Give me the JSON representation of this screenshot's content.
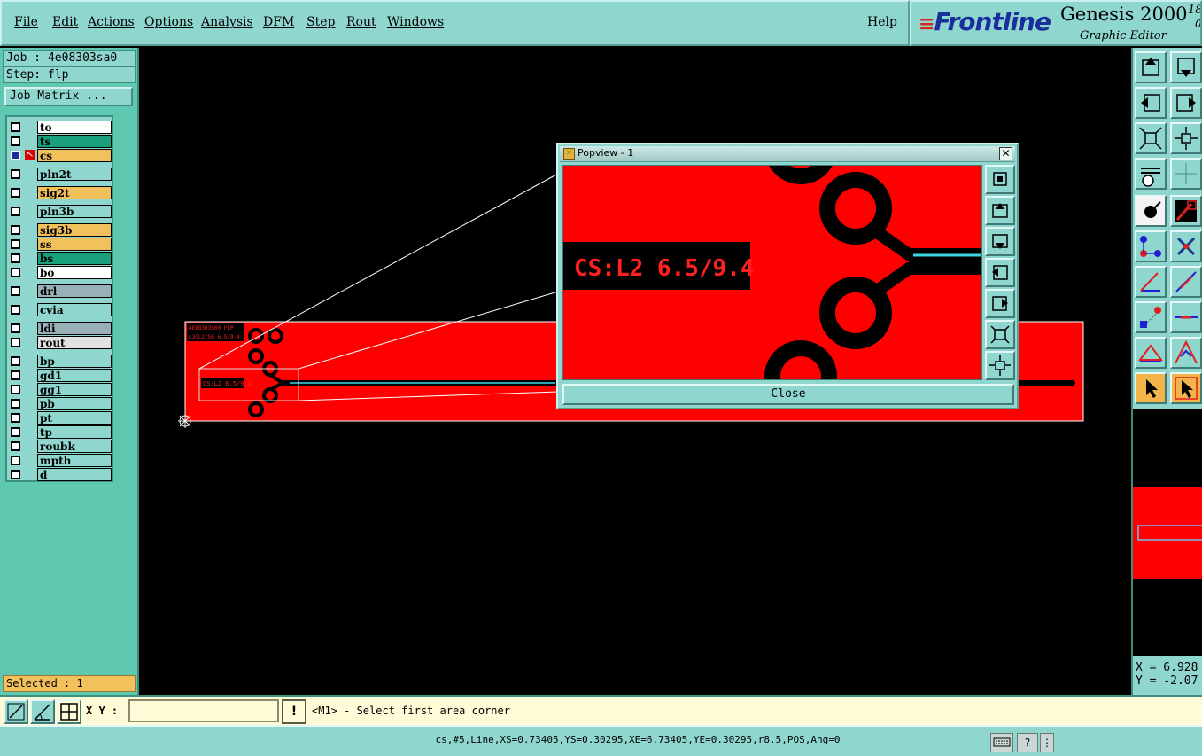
{
  "menu": {
    "items": [
      "File",
      "Edit",
      "Actions",
      "Options",
      "Analysis",
      "DFM",
      "Step",
      "Rout",
      "Windows"
    ],
    "help": "Help"
  },
  "brand": {
    "logo": "Frontline",
    "product": "Genesis 2000",
    "subtitle": "Graphic Editor",
    "version_top": "18",
    "version_bottom": "0"
  },
  "job": {
    "job_label": "Job : 4e08303sa0",
    "step_label": "Step: flp",
    "matrix_button": "Job Matrix ..."
  },
  "layers": [
    {
      "name": "to",
      "color": "#ffffff"
    },
    {
      "name": "ts",
      "color": "#1aa07a"
    },
    {
      "name": "cs",
      "color": "#f3c15c",
      "active": true
    },
    {
      "name": "pln2t",
      "color": "#8fd6cf"
    },
    {
      "name": "sig2t",
      "color": "#f3c15c"
    },
    {
      "name": "pln3b",
      "color": "#8fd6cf"
    },
    {
      "name": "sig3b",
      "color": "#f3c15c"
    },
    {
      "name": "ss",
      "color": "#f3c15c"
    },
    {
      "name": "bs",
      "color": "#1aa07a"
    },
    {
      "name": "bo",
      "color": "#ffffff"
    },
    {
      "name": "drl",
      "color": "#9ab0b8"
    },
    {
      "name": "cvia",
      "color": "#8fd6cf"
    },
    {
      "name": "ldi",
      "color": "#9ab0b8"
    },
    {
      "name": "rout",
      "color": "#e2e2e2"
    },
    {
      "name": "bp",
      "color": "#8fd6cf"
    },
    {
      "name": "gd1",
      "color": "#8fd6cf"
    },
    {
      "name": "gg1",
      "color": "#8fd6cf"
    },
    {
      "name": "pb",
      "color": "#8fd6cf"
    },
    {
      "name": "pt",
      "color": "#8fd6cf"
    },
    {
      "name": "tp",
      "color": "#8fd6cf"
    },
    {
      "name": "roubk",
      "color": "#8fd6cf"
    },
    {
      "name": "mpth",
      "color": "#8fd6cf"
    },
    {
      "name": "d",
      "color": "#8fd6cf"
    }
  ],
  "selected": "Selected : 1",
  "canvas": {
    "board_label_1": "4E08303S00 FLP",
    "board_label_2": "L3CL2/S6 6.5/9.4",
    "board_small_text": "CS:L2 6.5/9.4"
  },
  "popview": {
    "title": "Popview - 1",
    "close_x": "✕",
    "view_text": "CS:L2 6.5/9.4",
    "close_button": "Close"
  },
  "coords": {
    "x": "X = 6.928",
    "y": "Y = -2.07"
  },
  "cmdbar": {
    "xy_label": "X Y :",
    "xy_value": "",
    "xy_button": "!",
    "prompt": "<M1> - Select first area corner"
  },
  "status": {
    "text": "cs,#5,Line,XS=0.73405,YS=0.30295,XE=6.73405,YE=0.30295,r8.5,POS,Ang=0",
    "help_icon": "?",
    "menu_icon": "⋮"
  },
  "colors": {
    "panel": "#8fd6cf",
    "board_red": "#ff0000",
    "highlight_cyan": "#3ad7e4"
  }
}
